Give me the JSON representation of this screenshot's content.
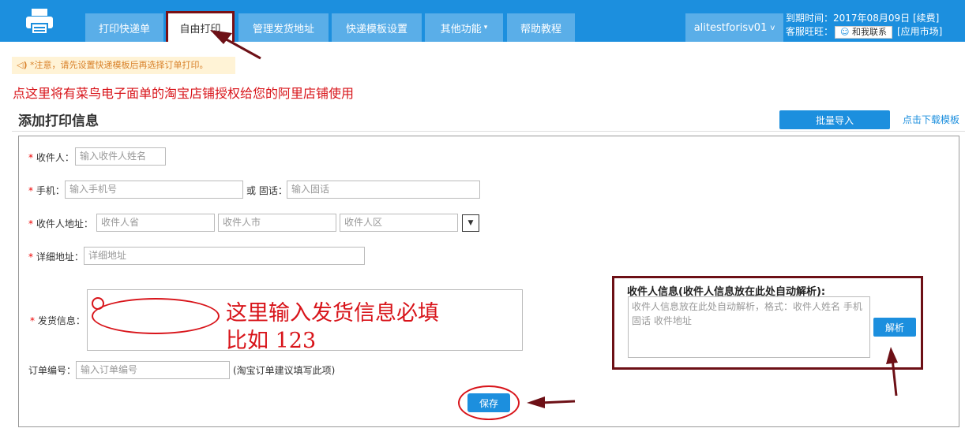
{
  "header": {
    "nav": [
      "打印快递单",
      "自由打印",
      "管理发货地址",
      "快递模板设置",
      "其他功能",
      "帮助教程"
    ],
    "user": "alitestforisv01",
    "expire_label": "到期时间：",
    "expire_date": "2017年08月09日",
    "renew": "[续费]",
    "service_label": "客服旺旺：",
    "contact": "和我联系",
    "market": "[应用市场]"
  },
  "notice": "*注意，请先设置快递模板后再选择订单打印。",
  "promo": "点这里将有菜鸟电子面单的淘宝店铺授权给您的阿里店铺使用",
  "section_title": "添加打印信息",
  "batch_import": "批量导入",
  "download_template": "点击下载模板",
  "form": {
    "receiver_label": "收件人：",
    "receiver_ph": "输入收件人姓名",
    "mobile_label": "手机：",
    "mobile_ph": "输入手机号",
    "or_phone_label": "或 固话：",
    "phone_ph": "输入固话",
    "address_label": "收件人地址：",
    "province_ph": "收件人省",
    "city_ph": "收件人市",
    "district_ph": "收件人区",
    "detail_label": "详细地址：",
    "detail_ph": "详细地址",
    "sender_label": "发货信息：",
    "order_label": "订单编号：",
    "order_ph": "输入订单编号",
    "order_hint": "(淘宝订单建议填写此项)",
    "save": "保存"
  },
  "parse": {
    "title": "收件人信息(收件人信息放在此处自动解析):",
    "placeholder": "收件人信息放在此处自动解析，格式：收件人姓名 手机 固话 收件地址",
    "button": "解析"
  },
  "annotation": {
    "line1": "这里输入发货信息必填",
    "line2": "比如 123"
  },
  "colors": {
    "primary": "#1c8fde",
    "annotation_red": "#d8141a",
    "highlight_maroon": "#6d1016"
  }
}
